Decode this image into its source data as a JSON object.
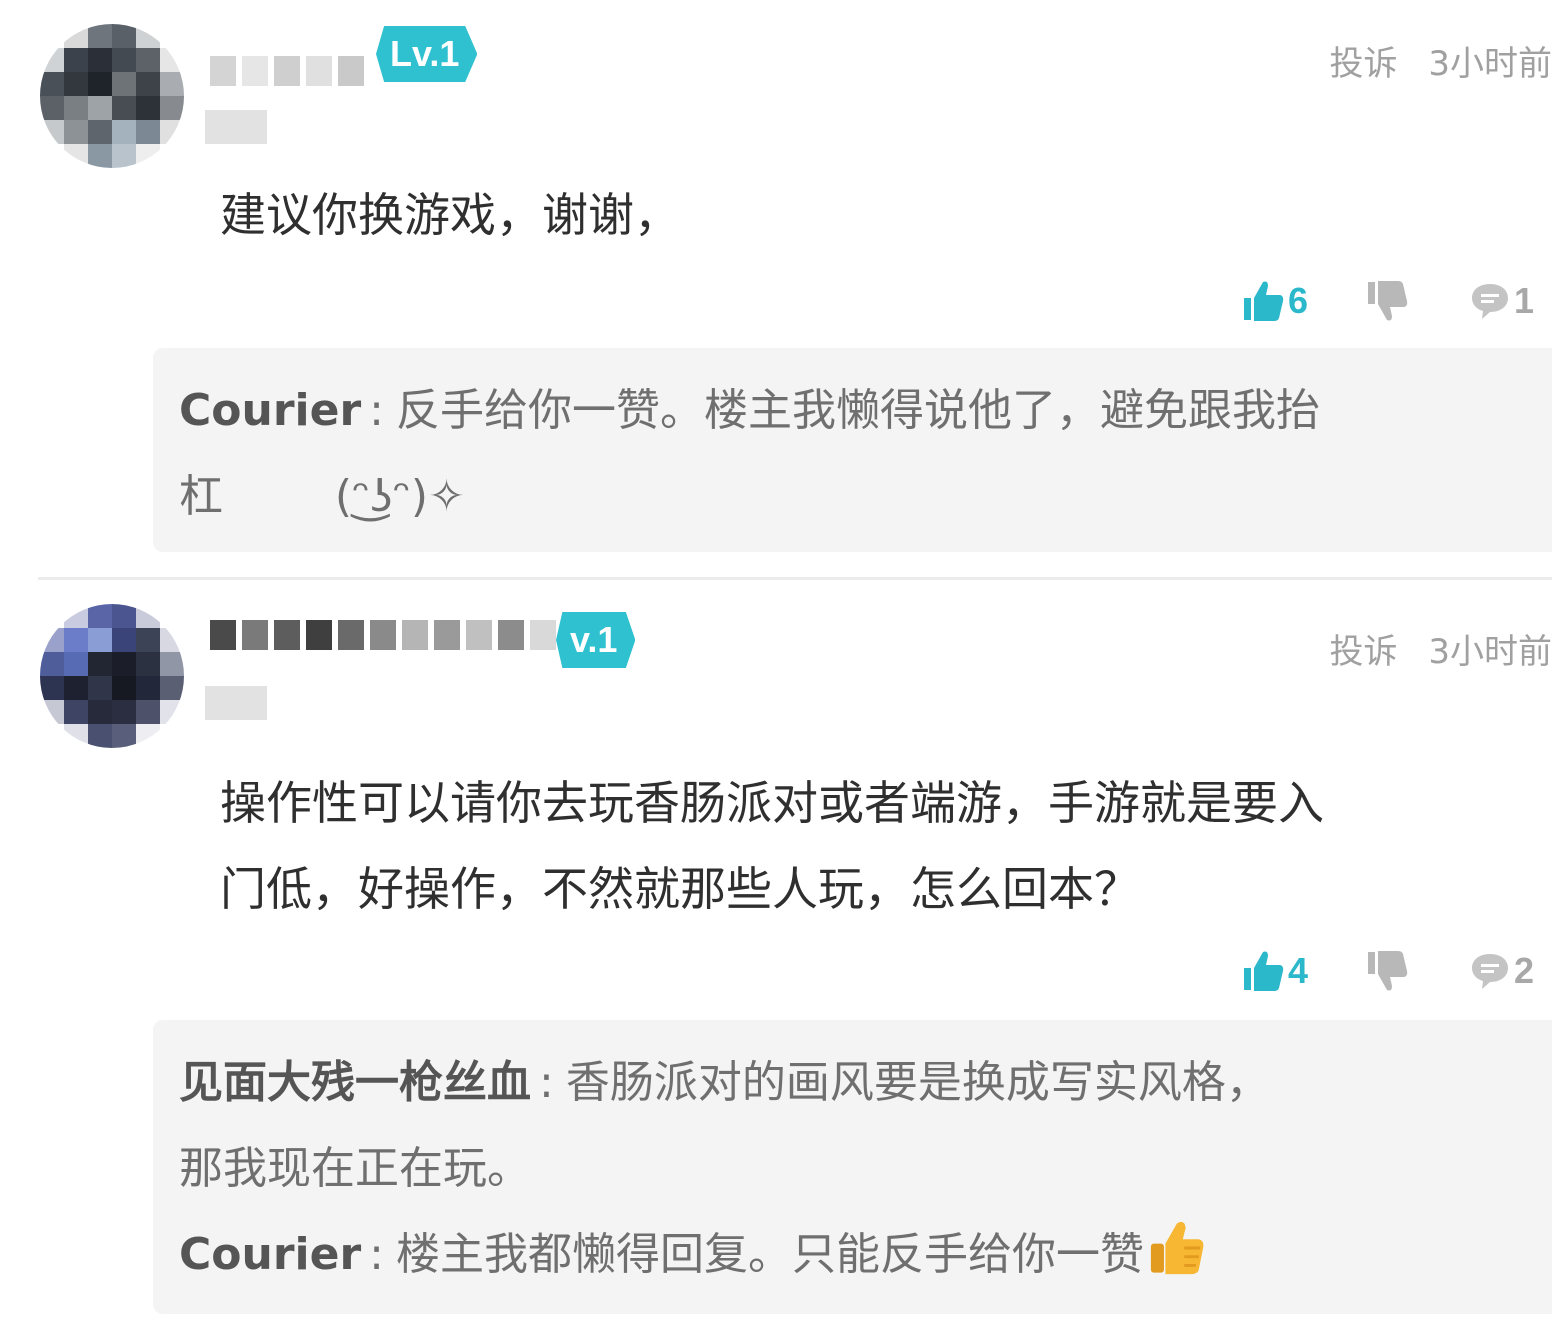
{
  "comments": [
    {
      "level": "Lv.1",
      "report_label": "投诉",
      "time": "3小时前",
      "text": "建议你换游戏，谢谢，",
      "likes": "6",
      "replies_count": "1",
      "replies": [
        {
          "author": "Courier",
          "separator": ":",
          "text_line1": "反手给你一赞。楼主我懒得说他了，避免跟我抬",
          "text_line2": "杠        (ᵔ͜ʖᵔ)✧"
        }
      ]
    },
    {
      "level": "v.1",
      "report_label": "投诉",
      "time": "3小时前",
      "text_line1": "操作性可以请你去玩香肠派对或者端游，手游就是要入",
      "text_line2": "门低，好操作，不然就那些人玩，怎么回本？",
      "likes": "4",
      "replies_count": "2",
      "replies": [
        {
          "author": "见面大残一枪丝血",
          "separator": ":",
          "text_line1": "香肠派对的画风要是换成写实风格，",
          "text_line2": "那我现在正在玩。"
        },
        {
          "author": "Courier",
          "separator": ":",
          "text_line1": "楼主我都懒得回复。只能反手给你一赞"
        }
      ]
    }
  ],
  "colors": {
    "accent": "#2bb8cb",
    "badge": "#2fc1d0",
    "muted": "#a0a0a0",
    "reply_bg": "#f4f4f4"
  },
  "icons": {
    "like": "thumbs-up-icon",
    "dislike": "thumbs-down-icon",
    "reply": "speech-bubble-icon"
  }
}
